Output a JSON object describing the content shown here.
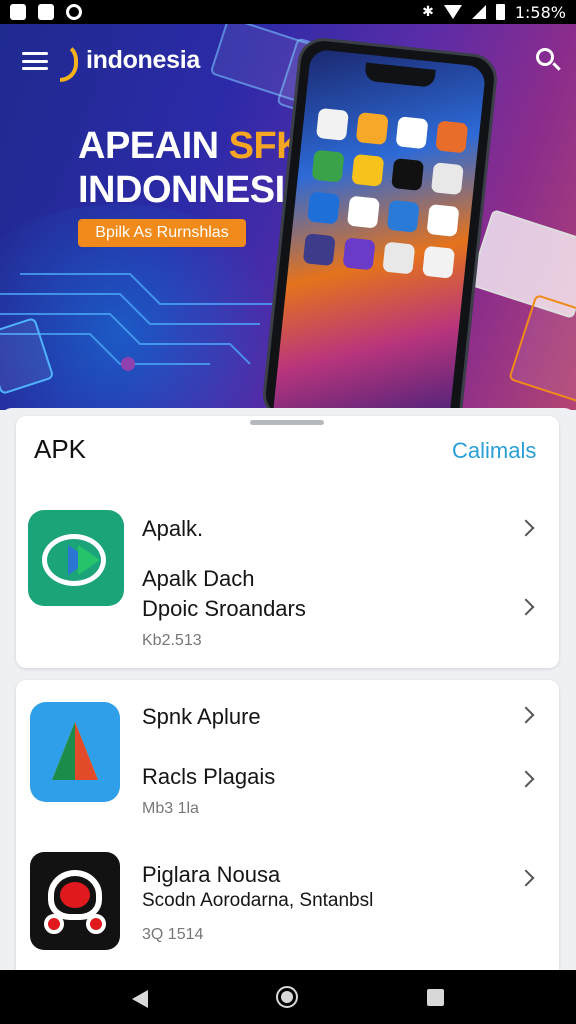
{
  "status_bar": {
    "time": "1:58%",
    "bluetooth": "✱",
    "icons": [
      "image-icon",
      "save-icon",
      "sync-icon",
      "bluetooth-icon",
      "wifi-icon",
      "cell-signal-icon",
      "battery-icon"
    ]
  },
  "header": {
    "brand": "indonesia",
    "menu_icon": "menu-icon",
    "search_icon": "search-icon"
  },
  "hero": {
    "line1_main": "APEAIN ",
    "line1_accent": "SFK",
    "line2": "INDONNESIA",
    "badge": "Bpilk As Rurnshlas",
    "colors": {
      "accent": "#f5a623",
      "badge": "#f08a1a"
    }
  },
  "section": {
    "title": "APK",
    "action": "Calimals"
  },
  "apps": [
    {
      "title": "Apalk.",
      "subtitle_1": "Apalk Dach",
      "subtitle_2": "Dpoic Sroandars",
      "meta": "Kb2.513",
      "icon": "play-arrows-icon",
      "color": "#1ba37a"
    },
    {
      "title": "Spnk Aplure",
      "subtitle_1": "Racls Plagais",
      "meta": "Mb3 1la",
      "icon": "triangle-a-icon",
      "color": "#2e9fe8"
    },
    {
      "title": "Piglara Nousa",
      "subtitle_1": "Scodn Aorodarna, Sntanbsl",
      "meta": "3Q 1514",
      "icon": "robot-face-icon",
      "color": "#121212"
    }
  ],
  "nav": {
    "back_icon": "back-icon",
    "home_icon": "home-icon",
    "recent_icon": "recents-icon"
  }
}
